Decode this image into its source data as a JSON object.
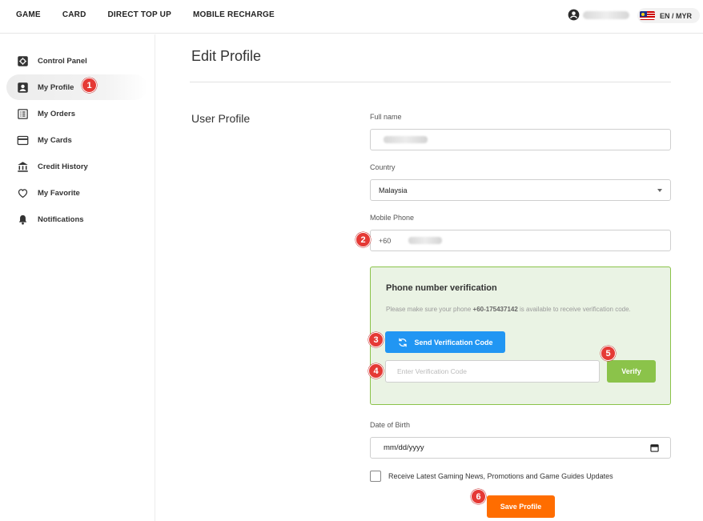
{
  "nav": {
    "items": [
      "GAME",
      "CARD",
      "DIRECT TOP UP",
      "MOBILE RECHARGE"
    ],
    "language_label": "EN / MYR"
  },
  "sidebar": {
    "items": [
      {
        "label": "Control Panel",
        "icon": "control-panel-icon"
      },
      {
        "label": "My Profile",
        "icon": "profile-icon",
        "active": true
      },
      {
        "label": "My Orders",
        "icon": "orders-icon"
      },
      {
        "label": "My Cards",
        "icon": "card-icon"
      },
      {
        "label": "Credit History",
        "icon": "bank-icon"
      },
      {
        "label": "My Favorite",
        "icon": "heart-icon"
      },
      {
        "label": "Notifications",
        "icon": "bell-icon"
      }
    ]
  },
  "main": {
    "title": "Edit Profile",
    "section_title": "User Profile",
    "full_name_label": "Full name",
    "country_label": "Country",
    "country_value": "Malaysia",
    "mobile_label": "Mobile Phone",
    "phone_prefix": "+60",
    "verification": {
      "title": "Phone number verification",
      "text_before": "Please make sure your phone ",
      "phone": "+60-175437142",
      "text_after": " is available to receive verification code.",
      "send_label": "Send Verification Code",
      "code_placeholder": "Enter Verification Code",
      "verify_label": "Verify"
    },
    "dob_label": "Date of Birth",
    "dob_placeholder": "mm/dd/yyyy",
    "newsletter_label": "Receive Latest Gaming News, Promotions and Game Guides Updates",
    "save_label": "Save Profile"
  },
  "badges": [
    "1",
    "2",
    "3",
    "4",
    "5",
    "6"
  ],
  "colors": {
    "accent_blue": "#2196f3",
    "accent_green": "#8bc34a",
    "save_orange": "#ff6d00",
    "badge_red": "#e53935"
  }
}
